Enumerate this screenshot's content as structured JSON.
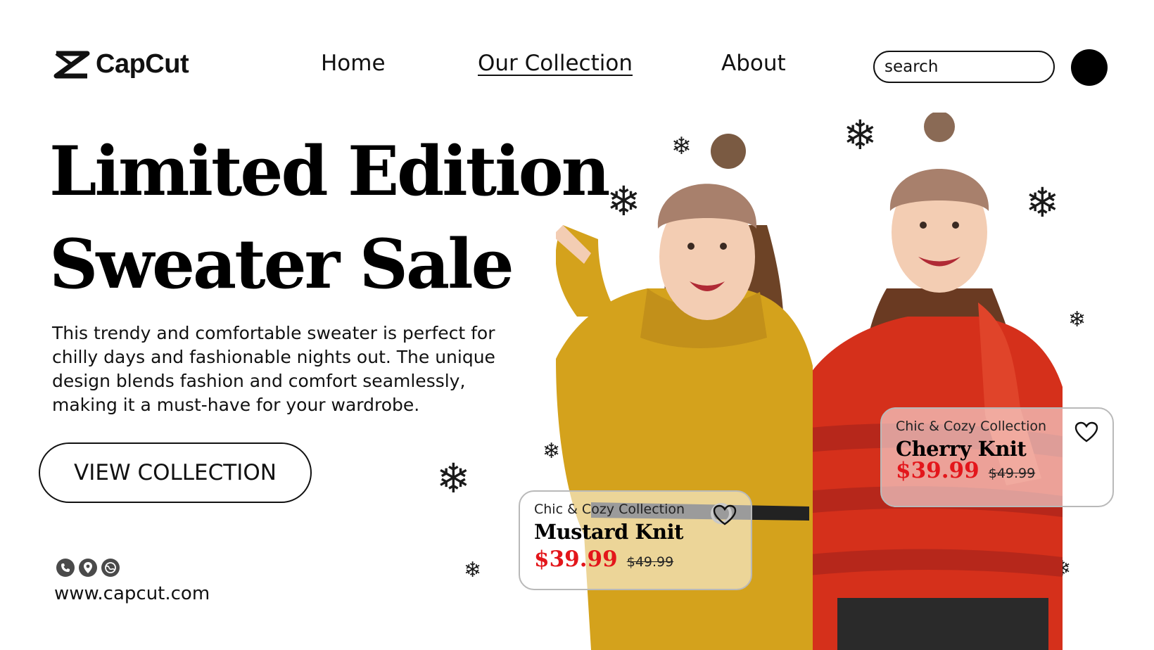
{
  "header": {
    "brand": "CapCut",
    "nav": [
      {
        "label": "Home",
        "active": false
      },
      {
        "label": "Our Collection",
        "active": true
      },
      {
        "label": "About",
        "active": false
      }
    ],
    "search_placeholder": "search"
  },
  "hero": {
    "headline_line1": "Limited Edition",
    "headline_line2": "Sweater Sale",
    "description": "This trendy and comfortable sweater is perfect for chilly days and fashionable nights out. The unique design blends fashion and comfort seamlessly, making it a must-have for your wardrobe.",
    "cta_label": "VIEW COLLECTION"
  },
  "footer": {
    "contact_icons": [
      "phone-icon",
      "location-pin-icon",
      "globe-icon"
    ],
    "website": "www.capcut.com"
  },
  "products": [
    {
      "collection": "Chic & Cozy Collection",
      "name": "Mustard Knit",
      "price": "$39.99",
      "old_price": "$49.99",
      "icon": "heart-icon"
    },
    {
      "collection": "Chic & Cozy Collection",
      "name": "Cherry Knit",
      "price": "$39.99",
      "old_price": "$49.99",
      "icon": "heart-icon"
    }
  ],
  "colors": {
    "accent_price": "#e3161b",
    "sweater_mustard": "#d4a21c",
    "sweater_red": "#d5301b",
    "hat": "#a8806c",
    "text": "#111111"
  }
}
